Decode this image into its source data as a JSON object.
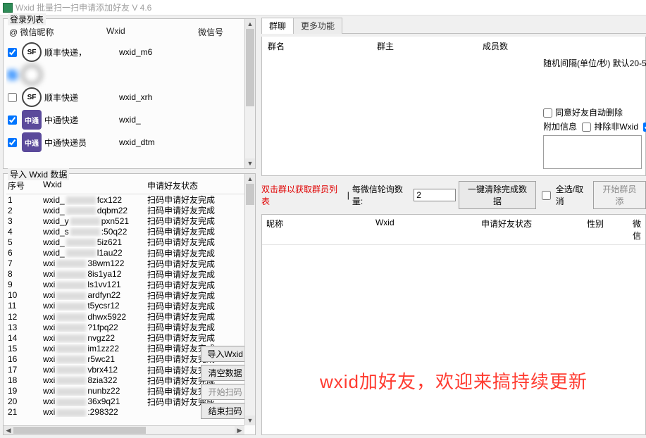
{
  "title": "Wxid 批量扫一扫申请添加好友 V 4.6",
  "login_box": {
    "title": "登录列表",
    "headers": {
      "nick": "@  微信昵称",
      "wxid": "Wxid",
      "acct": "微信号"
    },
    "rows": [
      {
        "avatar": "SF",
        "nick": "顺丰快递，",
        "wxid": "wxid_m6",
        "checked": true,
        "blurred": false,
        "type": "sf"
      },
      {
        "avatar": "",
        "nick": "",
        "wxid": "",
        "checked": true,
        "blurred": true,
        "type": "blur"
      },
      {
        "avatar": "SF",
        "nick": "顺丰快递",
        "wxid": "wxid_xrh",
        "checked": false,
        "blurred": false,
        "type": "sf"
      },
      {
        "avatar": "",
        "nick": "中通快递",
        "wxid": "wxid_",
        "checked": true,
        "blurred": false,
        "type": "zt"
      },
      {
        "avatar": "",
        "nick": "中通快递员",
        "wxid": "wxid_dtm",
        "checked": true,
        "blurred": false,
        "type": "zt"
      }
    ]
  },
  "wxid_box": {
    "title": "导入 Wxid 数据",
    "headers": {
      "idx": "序号",
      "wxid": "Wxid",
      "status": "申请好友状态"
    },
    "rows": [
      {
        "idx": "1",
        "wxid": "wxid_",
        "suffix": "fcx122",
        "status": "扫码申请好友完成"
      },
      {
        "idx": "2",
        "wxid": "wxid_",
        "suffix": "dqbm22",
        "status": "扫码申请好友完成"
      },
      {
        "idx": "3",
        "wxid": "wxid_y",
        "suffix": "pxn521",
        "status": "扫码申请好友完成"
      },
      {
        "idx": "4",
        "wxid": "wxid_s",
        "suffix": ":50q22",
        "status": "扫码申请好友完成"
      },
      {
        "idx": "5",
        "wxid": "wxid_",
        "suffix": "5iz621",
        "status": "扫码申请好友完成"
      },
      {
        "idx": "6",
        "wxid": "wxid_",
        "suffix": "l1au22",
        "status": "扫码申请好友完成"
      },
      {
        "idx": "7",
        "wxid": "wxi",
        "suffix": "38wm122",
        "status": "扫码申请好友完成"
      },
      {
        "idx": "8",
        "wxid": "wxi",
        "suffix": "8is1ya12",
        "status": "扫码申请好友完成"
      },
      {
        "idx": "9",
        "wxid": "wxi",
        "suffix": "ls1vv121",
        "status": "扫码申请好友完成"
      },
      {
        "idx": "10",
        "wxid": "wxi",
        "suffix": "ardfyn22",
        "status": "扫码申请好友完成"
      },
      {
        "idx": "11",
        "wxid": "wxi",
        "suffix": "t5ycsr12",
        "status": "扫码申请好友完成"
      },
      {
        "idx": "12",
        "wxid": "wxi",
        "suffix": "dhwx5922",
        "status": "扫码申请好友完成"
      },
      {
        "idx": "13",
        "wxid": "wxi",
        "suffix": "?1fpq22",
        "status": "扫码申请好友完成"
      },
      {
        "idx": "14",
        "wxid": "wxi",
        "suffix": "nvgz22",
        "status": "扫码申请好友完成"
      },
      {
        "idx": "15",
        "wxid": "wxi",
        "suffix": "im1zz22",
        "status": "扫码申请好友完成"
      },
      {
        "idx": "16",
        "wxid": "wxi",
        "suffix": "r5wc21",
        "status": "扫码申请好友完成"
      },
      {
        "idx": "17",
        "wxid": "wxi",
        "suffix": "vbrx412",
        "status": "扫码申请好友完成"
      },
      {
        "idx": "18",
        "wxid": "wxi",
        "suffix": "8zia322",
        "status": "扫码申请好友完成"
      },
      {
        "idx": "19",
        "wxid": "wxi",
        "suffix": "nunbz22",
        "status": "扫码申请好友完成"
      },
      {
        "idx": "20",
        "wxid": "wxi",
        "suffix": "36x9q21",
        "status": "扫码申请好友完成"
      },
      {
        "idx": "21",
        "wxid": "wxi",
        "suffix": ":298322",
        "status": ""
      }
    ],
    "buttons": {
      "import": "导入Wxid",
      "clear": "清空数据",
      "start": "开始扫码",
      "stop": "结束扫码"
    }
  },
  "tabs": {
    "chat": "群聊",
    "more": "更多功能"
  },
  "group_headers": {
    "name": "群名",
    "owner": "群主",
    "members": "成员数"
  },
  "side": {
    "interval_lbl": "随机间隔(单位/秒) 默认20-5",
    "agree_lbl": "同意好友自动删除",
    "attach_lbl": "附加信息",
    "exclude_lbl": "排除非Wxid"
  },
  "action": {
    "hint": "双击群以获取群员列表",
    "poll_lbl": "每微信轮询数量:",
    "poll_val": "2",
    "clear_done": "一键清除完成数据",
    "select_all": "全选/取消",
    "start_members": "开始群员添"
  },
  "lower_headers": {
    "nick": "昵称",
    "wxid": "Wxid",
    "status": "申请好友状态",
    "gender": "性别",
    "wx": "微信"
  },
  "promo": "wxid加好友，欢迎来搞持续更新"
}
